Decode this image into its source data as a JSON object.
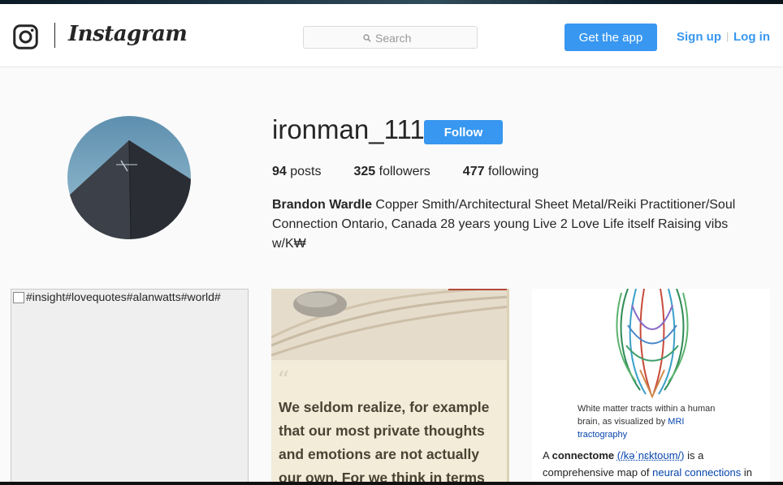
{
  "header": {
    "brand": "Instagram",
    "search_placeholder": "Search",
    "get_app_label": "Get the app",
    "signup_label": "Sign up",
    "separator": "|",
    "login_label": "Log in"
  },
  "profile": {
    "username": "ironman_111",
    "follow_label": "Follow",
    "stats": [
      {
        "count": "94",
        "label": "posts"
      },
      {
        "count": "325",
        "label": "followers"
      },
      {
        "count": "477",
        "label": "following"
      }
    ],
    "full_name": "Brandon Wardle",
    "bio": "Copper Smith/Architectural Sheet Metal/Reiki Practitioner/Soul Connection Ontario, Canada 28 years young Live 2 Love Life itself Raising vibs w/K₩"
  },
  "posts": [
    {
      "alt": "#insight#lovequotes#alanwatts#world#"
    },
    {
      "quote_mark": "“",
      "quote_lines": [
        "We seldom realize, for example",
        "that our most private thoughts",
        "and emotions are not actually",
        "our own. For we think in terms"
      ]
    },
    {
      "caption_pre": "White matter tracts within a human brain, as visualized by",
      "caption_link1": "MRI",
      "caption_link2": "tractography",
      "text_a": "A",
      "text_term": "connectome",
      "text_ipa": "(/kəˈnɛktoʊm/)",
      "text_b": "is a comprehensive map of",
      "text_link": "neural connections",
      "text_c": "in"
    }
  ]
}
